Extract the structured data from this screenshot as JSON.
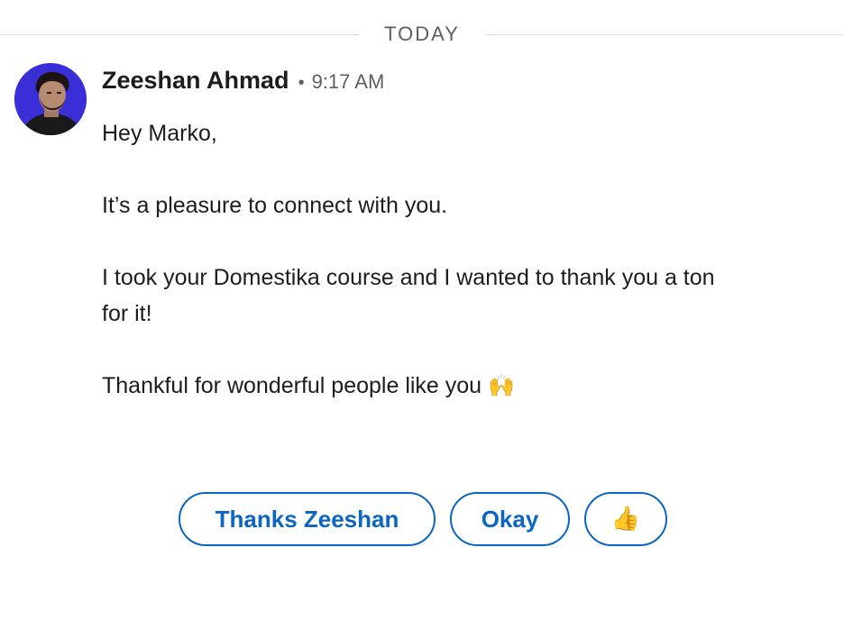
{
  "divider": {
    "label": "TODAY"
  },
  "message": {
    "sender": "Zeeshan Ahmad",
    "separator": "•",
    "time": "9:17 AM",
    "paragraphs": [
      "Hey Marko,",
      "It’s a pleasure to connect with you.",
      "I took your Domestika course and I wanted to thank you a ton for it!",
      "Thankful for wonderful people like you"
    ],
    "closing_emoji": "🙌",
    "closing_emoji_icon": "raising-hands-icon"
  },
  "avatar": {
    "background": "#3a2fd6",
    "icon": "avatar-photo"
  },
  "quick_replies": [
    {
      "label": "Thanks Zeeshan"
    },
    {
      "label": "Okay"
    },
    {
      "label": "👍",
      "icon": "thumbs-up-icon"
    }
  ],
  "colors": {
    "accent": "#0a66c2",
    "text": "#1d1d1d",
    "muted": "#5e5e5e",
    "divider": "#d9d9d9"
  }
}
